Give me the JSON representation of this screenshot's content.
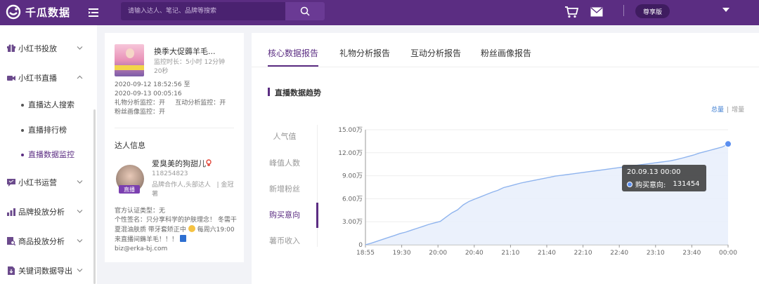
{
  "app": {
    "name": "千瓜数据"
  },
  "header": {
    "search_placeholder": "请输入达人、笔记、品牌等搜索",
    "vip_label": "尊享版"
  },
  "sidebar": {
    "items": [
      {
        "label": "小红书投放",
        "icon": "gift-icon",
        "expanded": false
      },
      {
        "label": "小红书直播",
        "icon": "video-icon",
        "expanded": true
      },
      {
        "label": "小红书运营",
        "icon": "chat-icon",
        "expanded": false
      },
      {
        "label": "品牌投放分析",
        "icon": "bar-chart-icon",
        "expanded": false
      },
      {
        "label": "商品投放分析",
        "icon": "list-search-icon",
        "expanded": false
      },
      {
        "label": "关键词数据导出",
        "icon": "export-icon",
        "expanded": false
      }
    ],
    "subitems": [
      {
        "label": "直播达人搜索",
        "active": false
      },
      {
        "label": "直播排行榜",
        "active": false
      },
      {
        "label": "直播数据监控",
        "active": true
      }
    ]
  },
  "live_card": {
    "title": "换季大促薅羊毛...",
    "duration_label": "监控时长：",
    "duration_value": "5小时 12分钟 20秒",
    "time_start": "2020-09-12 18:52:56 至",
    "time_end": "2020-09-13 00:05:16",
    "monitors_line1": "礼物分析监控：开     互动分析监控：开",
    "monitors_line2": "粉丝画像监控：开"
  },
  "kol": {
    "section_title": "达人信息",
    "name": "爱臭美的狗甜儿",
    "id": "118254823",
    "tags": "品牌合作人,头部达人   | 金冠薯",
    "live_badge": "直播",
    "cert": "官方认证类型：无",
    "bio_part1": "个性签名：只分享科学的护肤理念！ 冬需干夏混油肤质 带牙套矫正中",
    "bio_part2": "每周六19:00来直播间薅羊毛！！！",
    "bio_email": "biz@erka-bj.com"
  },
  "tabs": [
    {
      "label": "核心数据报告",
      "active": true
    },
    {
      "label": "礼物分析报告",
      "active": false
    },
    {
      "label": "互动分析报告",
      "active": false
    },
    {
      "label": "粉丝画像报告",
      "active": false
    }
  ],
  "chart_section": {
    "title": "直播数据趋势",
    "toggle_total": "总量",
    "toggle_sep": "|",
    "toggle_increment": "增量",
    "metrics": [
      {
        "label": "人气值",
        "active": false
      },
      {
        "label": "峰值人数",
        "active": false
      },
      {
        "label": "新增粉丝",
        "active": false
      },
      {
        "label": "购买意向",
        "active": true
      },
      {
        "label": "薯币收入",
        "active": false
      }
    ]
  },
  "tooltip": {
    "time": "20.09.13 00:00",
    "series": "购买意向:",
    "value": "131454"
  },
  "colors": {
    "brand": "#5b2d82",
    "line": "#8fb4ee",
    "area": "#e7eefb",
    "point": "#5b8ff0"
  },
  "chart_data": {
    "type": "area",
    "title": "直播数据趋势",
    "series_name": "购买意向",
    "x_ticks": [
      "18:55",
      "19:30",
      "20:00",
      "20:40",
      "21:10",
      "21:40",
      "22:10",
      "22:40",
      "23:10",
      "23:40",
      "00:00"
    ],
    "y_ticks": [
      "0",
      "3.00万",
      "6.00万",
      "9.00万",
      "12.00万",
      "15.00万"
    ],
    "ylim": [
      0,
      150000
    ],
    "x": [
      0,
      5,
      10,
      15,
      20,
      25,
      30,
      35,
      40,
      45,
      50,
      55,
      60,
      65,
      70,
      75,
      80,
      85,
      90,
      95,
      100,
      105,
      110,
      115,
      120,
      125,
      130,
      135,
      140,
      145,
      150,
      155,
      160,
      165,
      170,
      175,
      180,
      185,
      190,
      195,
      200,
      205,
      210,
      215,
      220,
      225,
      230,
      235,
      240,
      245,
      250,
      255,
      260,
      265,
      270,
      275,
      280,
      285,
      290,
      295,
      300,
      305,
      310,
      315
    ],
    "values": [
      0,
      2000,
      4500,
      7000,
      9500,
      12000,
      14500,
      16500,
      19000,
      21500,
      24000,
      26500,
      28500,
      30500,
      36000,
      41500,
      45500,
      52000,
      56500,
      59500,
      62500,
      65500,
      68500,
      71000,
      74500,
      76500,
      78500,
      80500,
      82000,
      83500,
      85000,
      86500,
      88000,
      89500,
      90500,
      91500,
      92500,
      93500,
      94500,
      95500,
      96500,
      97500,
      98500,
      99500,
      100500,
      101500,
      102500,
      103500,
      104500,
      105500,
      106500,
      107500,
      108500,
      109500,
      111000,
      113000,
      115000,
      117000,
      119500,
      121500,
      123500,
      125500,
      127500,
      131454
    ]
  }
}
